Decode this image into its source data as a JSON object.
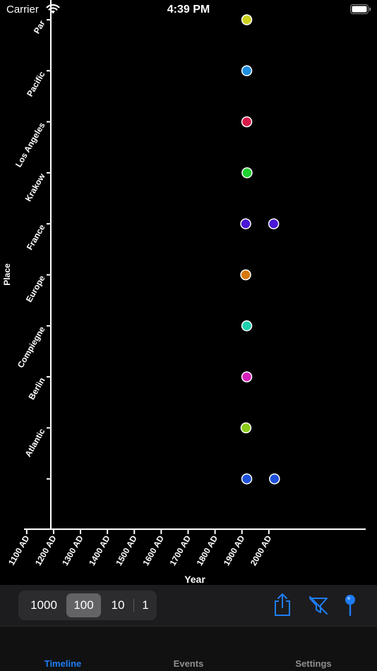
{
  "status_bar": {
    "carrier": "Carrier",
    "time": "4:39 PM"
  },
  "chart_data": {
    "type": "scatter",
    "xlabel": "Year",
    "ylabel": "Place",
    "x_ticks": [
      1100,
      1200,
      1300,
      1400,
      1500,
      1600,
      1700,
      1800,
      1900,
      2000
    ],
    "x_tick_labels": [
      "1100 AD",
      "1200 AD",
      "1300 AD",
      "1400 AD",
      "1500 AD",
      "1600 AD",
      "1700 AD",
      "1800 AD",
      "1900 AD",
      "2000 AD"
    ],
    "xlim": [
      1090,
      2360
    ],
    "categories": [
      "",
      "Atlantic",
      "Berlin",
      "Compiegne",
      "Europe",
      "France",
      "Krakow",
      "Los Angeles",
      "Pacific",
      "Par"
    ],
    "points": [
      {
        "place": "",
        "year": 1918,
        "color": "#1e4fd8"
      },
      {
        "place": "",
        "year": 2021,
        "color": "#1e4fd8"
      },
      {
        "place": "Atlantic",
        "year": 1915,
        "color": "#8ccc1c"
      },
      {
        "place": "Berlin",
        "year": 1918,
        "color": "#d620bb"
      },
      {
        "place": "Compiegne",
        "year": 1918,
        "color": "#1fd0ae"
      },
      {
        "place": "Europe",
        "year": 1914,
        "color": "#d5760f"
      },
      {
        "place": "France",
        "year": 1914,
        "color": "#4a18d6"
      },
      {
        "place": "France",
        "year": 2018,
        "color": "#4a18d6"
      },
      {
        "place": "Krakow",
        "year": 1919,
        "color": "#1fcf2e"
      },
      {
        "place": "Los Angeles",
        "year": 1918,
        "color": "#d61b4a"
      },
      {
        "place": "Pacific",
        "year": 1918,
        "color": "#1e8ddf"
      },
      {
        "place": "Par",
        "year": 1918,
        "color": "#cdd21f"
      }
    ]
  },
  "toolbar": {
    "zoom_options": [
      "1000",
      "100",
      "10",
      "1"
    ],
    "selected_zoom": "100",
    "icons": [
      "share-icon",
      "filter-off-icon",
      "pin-icon"
    ],
    "accent": "#1e7df5"
  },
  "tab_bar": {
    "tabs": [
      {
        "label": "Timeline",
        "active": true
      },
      {
        "label": "Events",
        "active": false
      },
      {
        "label": "Settings",
        "active": false
      }
    ]
  }
}
